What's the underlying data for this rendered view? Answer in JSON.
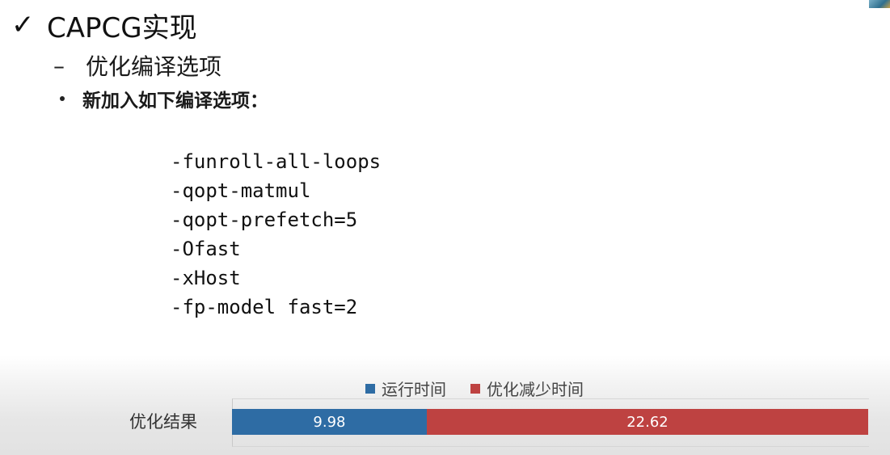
{
  "slide": {
    "title_icon": "check-mark-icon",
    "title": "CAPCG实现",
    "subheading_icon": "dash-icon",
    "subheading": "优化编译选项",
    "bullet": "新加入如下编译选项：",
    "options": [
      "-funroll-all-loops",
      "-qopt-matmul",
      "-qopt-prefetch=5",
      "-Ofast",
      "-xHost",
      "-fp-model fast=2"
    ]
  },
  "chart_data": {
    "type": "bar",
    "orientation": "horizontal",
    "stacked": true,
    "categories": [
      "优化结果"
    ],
    "series": [
      {
        "name": "运行时间",
        "values": [
          9.98
        ],
        "color": "#2e6ca4"
      },
      {
        "name": "优化减少时间",
        "values": [
          22.62
        ],
        "color": "#be4241"
      }
    ],
    "legend_position": "top",
    "data_labels": [
      "9.98",
      "22.62"
    ]
  }
}
